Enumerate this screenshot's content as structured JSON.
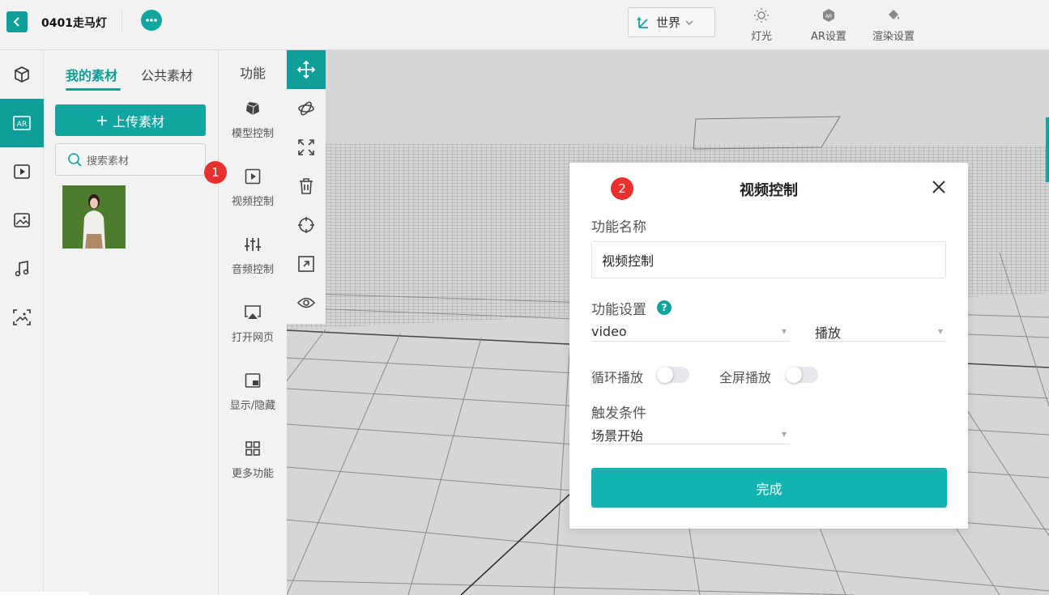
{
  "topbar": {
    "project_title": "0401走马灯",
    "world_label": "世界",
    "tools": [
      {
        "label": "灯光",
        "icon": "sun-icon"
      },
      {
        "label": "AR设置",
        "icon": "ar-settings-icon"
      },
      {
        "label": "渲染设置",
        "icon": "paint-bucket-icon"
      }
    ]
  },
  "assets": {
    "tab_mine": "我的素材",
    "tab_public": "公共素材",
    "upload_label": "上传素材",
    "search_placeholder": "搜索素材"
  },
  "functions": {
    "title": "功能",
    "items": [
      {
        "label": "模型控制",
        "icon": "cube-icon"
      },
      {
        "label": "视频控制",
        "icon": "video-play-icon"
      },
      {
        "label": "音频控制",
        "icon": "sliders-icon"
      },
      {
        "label": "打开网页",
        "icon": "airplay-icon"
      },
      {
        "label": "显示/隐藏",
        "icon": "picture-in-picture-icon"
      },
      {
        "label": "更多功能",
        "icon": "grid-icon"
      }
    ]
  },
  "badges": {
    "one": "1",
    "two": "2"
  },
  "modal": {
    "title": "视频控制",
    "name_label": "功能名称",
    "name_value": "视频控制",
    "settings_label": "功能设置",
    "help": "?",
    "select_target": "video",
    "select_action": "播放",
    "loop_label": "循环播放",
    "fullscreen_label": "全屏播放",
    "trigger_label": "触发条件",
    "trigger_value": "场景开始",
    "done_label": "完成"
  },
  "colors": {
    "accent": "#0f9e9a",
    "badge": "#e8312e",
    "done": "#12b3b0"
  }
}
